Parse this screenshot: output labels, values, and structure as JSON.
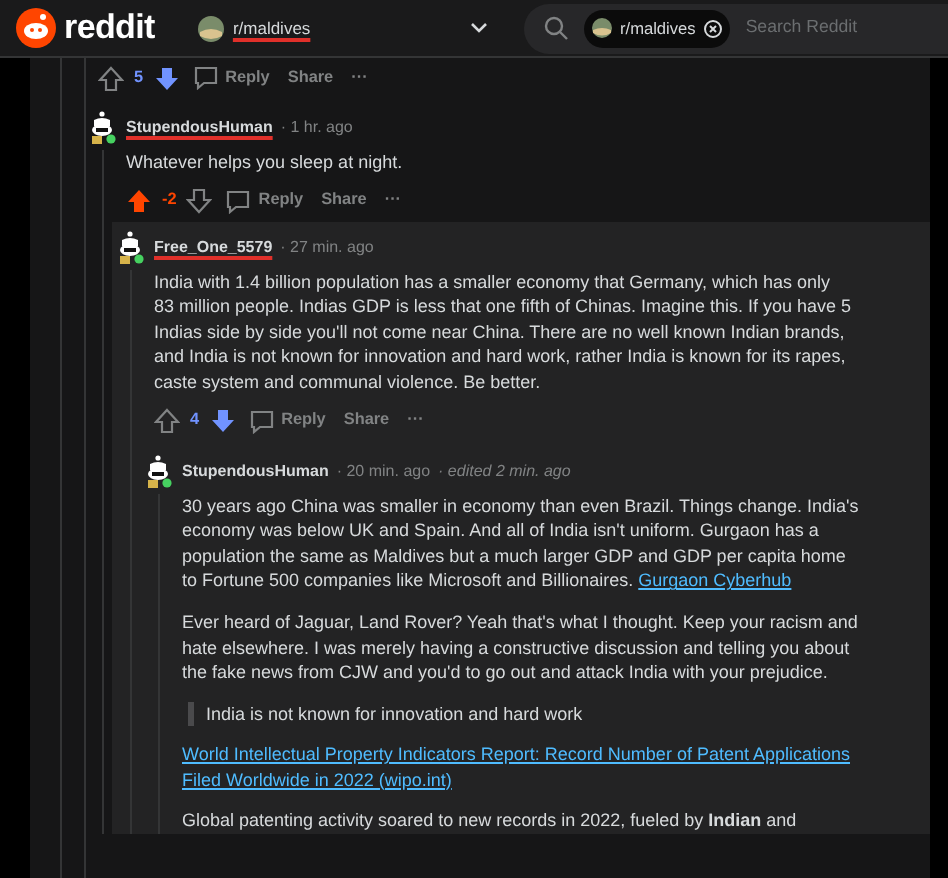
{
  "header": {
    "logo_text": "reddit",
    "community": {
      "name": "r/maldives",
      "redacted": true
    },
    "search": {
      "chip": "r/maldives",
      "placeholder": "Search Reddit"
    }
  },
  "top_actions": {
    "score": "5",
    "upvoted": false,
    "downvoted": true,
    "actions": [
      "Reply",
      "Share",
      "···"
    ]
  },
  "comments": [
    {
      "author": "StupendousHuman",
      "redacted": true,
      "time": "· 1 hr. ago",
      "highlighted": false,
      "blocks": [
        {
          "kind": "paragraph",
          "text": "Whatever helps you sleep at night."
        }
      ],
      "score": "-2",
      "upvoted": true,
      "downvoted": false,
      "actions": [
        "Reply",
        "Share",
        "···"
      ],
      "children": [
        {
          "author": "Free_One_5579",
          "redacted": true,
          "time": "· 27 min. ago",
          "highlighted": true,
          "blocks": [
            {
              "kind": "paragraph",
              "text": "India with 1.4 billion population has a smaller economy that Germany, which has only 83 million people. Indias GDP is less that one fifth of Chinas. Imagine this. If you have 5 Indias side by side you'll not come near China. There are no well known Indian brands, and India is not known for innovation and hard work, rather India is known for its rapes, caste system and communal violence. Be better."
            }
          ],
          "score": "4",
          "upvoted": false,
          "downvoted": true,
          "actions": [
            "Reply",
            "Share",
            "···"
          ],
          "children": [
            {
              "author": "StupendousHuman",
              "redacted": false,
              "time": "· 20 min. ago",
              "edited": "· edited 2 min. ago",
              "highlighted": false,
              "blocks": [
                {
                  "kind": "paragraph",
                  "text": "30 years ago China was smaller in economy than even Brazil. Things change. India's economy was below UK and Spain. And all of India isn't uniform. Gurgaon has a population the same as Maldives but a much larger GDP and GDP per capita home to Fortune 500 companies like Microsoft and Billionaires.",
                  "link": "Gurgaon Cyberhub"
                },
                {
                  "kind": "paragraph",
                  "text": "Ever heard of Jaguar, Land Rover? Yeah that's what I thought. Keep your racism and hate elsewhere. I was merely having a constructive discussion and telling you about the fake news from CJW and you'd to go out and attack India with your prejudice."
                },
                {
                  "kind": "quote",
                  "text": "India is not known for innovation and hard work"
                },
                {
                  "kind": "link",
                  "text": "World Intellectual Property Indicators Report: Record Number of Patent Applications Filed Worldwide in 2022 (wipo.int)"
                },
                {
                  "kind": "paragraph",
                  "text": "Global patenting activity soared to new records in 2022, fueled by **Indian** and"
                }
              ]
            }
          ]
        }
      ]
    }
  ]
}
